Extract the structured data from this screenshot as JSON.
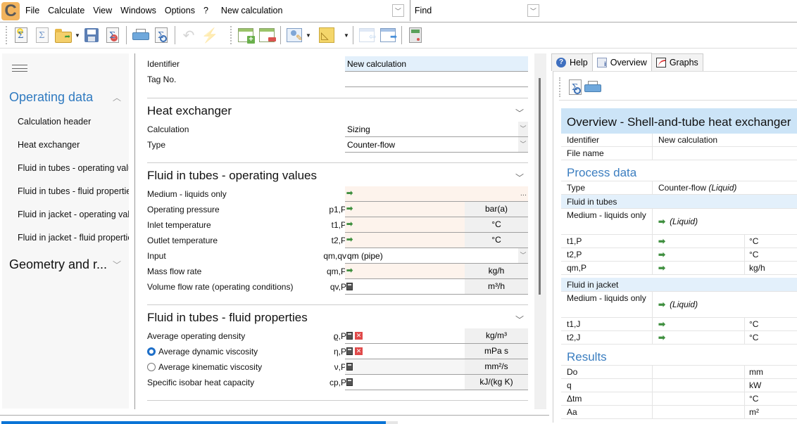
{
  "menubar": {
    "logo": "C",
    "items": [
      "File",
      "Calculate",
      "View",
      "Windows",
      "Options",
      "?"
    ],
    "document_selector": "New calculation",
    "find_label": "Find"
  },
  "toolbar": {
    "buttons": [
      {
        "name": "new-calculation",
        "icon": "new-sigma-doc-icon",
        "enabled": true
      },
      {
        "name": "duplicate-calculation",
        "icon": "copy-sigma-doc-icon",
        "enabled": true
      },
      {
        "name": "open",
        "icon": "open-folder-icon",
        "enabled": true,
        "dropdown": true
      },
      {
        "name": "save",
        "icon": "save-disk-icon",
        "enabled": true
      },
      {
        "name": "close-calculation",
        "icon": "close-sigma-doc-icon",
        "enabled": true
      },
      {
        "name": "print",
        "icon": "printer-icon",
        "enabled": true
      },
      {
        "name": "print-preview",
        "icon": "preview-icon",
        "enabled": true
      },
      {
        "name": "undo",
        "icon": "undo-icon",
        "enabled": false
      },
      {
        "name": "recalculate",
        "icon": "lightning-icon",
        "enabled": false
      },
      {
        "name": "add-row",
        "icon": "table-add-icon",
        "enabled": true
      },
      {
        "name": "remove-row",
        "icon": "table-remove-icon",
        "enabled": true
      },
      {
        "name": "edit-user-data",
        "icon": "user-edit-icon",
        "enabled": true,
        "dropdown": true
      },
      {
        "name": "geometry",
        "icon": "set-square-icon",
        "enabled": true,
        "dropdown": true
      },
      {
        "name": "import",
        "icon": "import-icon",
        "enabled": false
      },
      {
        "name": "export",
        "icon": "export-icon",
        "enabled": true
      },
      {
        "name": "calculator",
        "icon": "calculator-icon",
        "enabled": true
      }
    ]
  },
  "sidebar": {
    "groups": [
      {
        "label": "Operating data",
        "expanded": true,
        "items": [
          "Calculation header",
          "Heat exchanger",
          "Fluid in tubes - operating values",
          "Fluid in tubes - fluid properties",
          "Fluid in jacket - operating values",
          "Fluid in jacket - fluid properties"
        ]
      },
      {
        "label": "Geometry and r...",
        "expanded": false
      }
    ]
  },
  "form": {
    "header": {
      "identifier_label": "Identifier",
      "identifier_value": "New calculation",
      "tag_label": "Tag No.",
      "tag_value": ""
    },
    "heat_exchanger": {
      "title": "Heat exchanger",
      "calculation_label": "Calculation",
      "calculation_value": "Sizing",
      "type_label": "Type",
      "type_value": "Counter-flow"
    },
    "tubes_operating": {
      "title": "Fluid in tubes - operating values",
      "rows": [
        {
          "label": "Medium - liquids only",
          "symbol": "",
          "kind": "arrow",
          "unit": "",
          "ellipsis": "..."
        },
        {
          "label": "Operating pressure",
          "symbol": "p1,P",
          "kind": "arrow",
          "unit": "bar(a)"
        },
        {
          "label": "Inlet temperature",
          "symbol": "t1,P",
          "kind": "arrow",
          "unit": "°C"
        },
        {
          "label": "Outlet temperature",
          "symbol": "t2,P",
          "kind": "arrow",
          "unit": "°C"
        },
        {
          "label": "Input",
          "symbol": "qm,qv",
          "kind": "select",
          "value": "qm (pipe)"
        },
        {
          "label": "Mass flow rate",
          "symbol": "qm,P",
          "kind": "arrow",
          "unit": "kg/h"
        },
        {
          "label": "Volume flow rate (operating conditions)",
          "symbol": "qv,P",
          "kind": "calc",
          "unit": "m³/h"
        }
      ]
    },
    "tubes_properties": {
      "title": "Fluid in tubes - fluid properties",
      "rows": [
        {
          "label": "Average operating density",
          "symbol": "ϱ,P",
          "kind": "calc-x",
          "unit": "kg/m³"
        },
        {
          "label": "Average dynamic viscosity",
          "symbol": "η,P",
          "kind": "calc-x",
          "unit": "mPa s",
          "radio": "on"
        },
        {
          "label": "Average kinematic viscosity",
          "symbol": "ν,P",
          "kind": "calc",
          "unit": "mm²/s",
          "radio": "off"
        },
        {
          "label": "Specific isobar heat capacity",
          "symbol": "cp,P",
          "kind": "calc",
          "unit": "kJ/(kg K)"
        }
      ]
    }
  },
  "right_panel": {
    "tabs": [
      {
        "label": "Help",
        "icon": "help-icon",
        "active": false
      },
      {
        "label": "Overview",
        "icon": "overview-icon",
        "active": true
      },
      {
        "label": "Graphs",
        "icon": "graph-icon",
        "active": false
      }
    ],
    "overview": {
      "title": "Overview - Shell-and-tube heat exchanger",
      "identifier_label": "Identifier",
      "identifier_value": "New calculation",
      "file_name_label": "File name",
      "file_name_value": "",
      "process_heading": "Process data",
      "type_label": "Type",
      "type_value": "Counter-flow",
      "type_suffix": "(Liquid)",
      "tubes_heading": "Fluid in tubes",
      "tubes_medium_label": "Medium - liquids only",
      "tubes_medium_value": "(Liquid)",
      "tubes_rows": [
        {
          "symbol": "t1,P",
          "unit": "°C"
        },
        {
          "symbol": "t2,P",
          "unit": "°C"
        },
        {
          "symbol": "qm,P",
          "unit": "kg/h"
        }
      ],
      "jacket_heading": "Fluid in jacket",
      "jacket_medium_label": "Medium - liquids only",
      "jacket_medium_value": "(Liquid)",
      "jacket_rows": [
        {
          "symbol": "t1,J",
          "unit": "°C"
        },
        {
          "symbol": "t2,J",
          "unit": "°C"
        }
      ],
      "results_heading": "Results",
      "results_rows": [
        {
          "symbol": "Do",
          "value": "",
          "unit": "mm"
        },
        {
          "symbol": "q",
          "value": "",
          "unit": "kW"
        },
        {
          "symbol": "Δtm",
          "value": "",
          "unit": "°C"
        },
        {
          "symbol": "Aa",
          "value": "",
          "unit": "m²"
        }
      ]
    }
  },
  "status": {
    "progress_fraction": 0.97
  }
}
